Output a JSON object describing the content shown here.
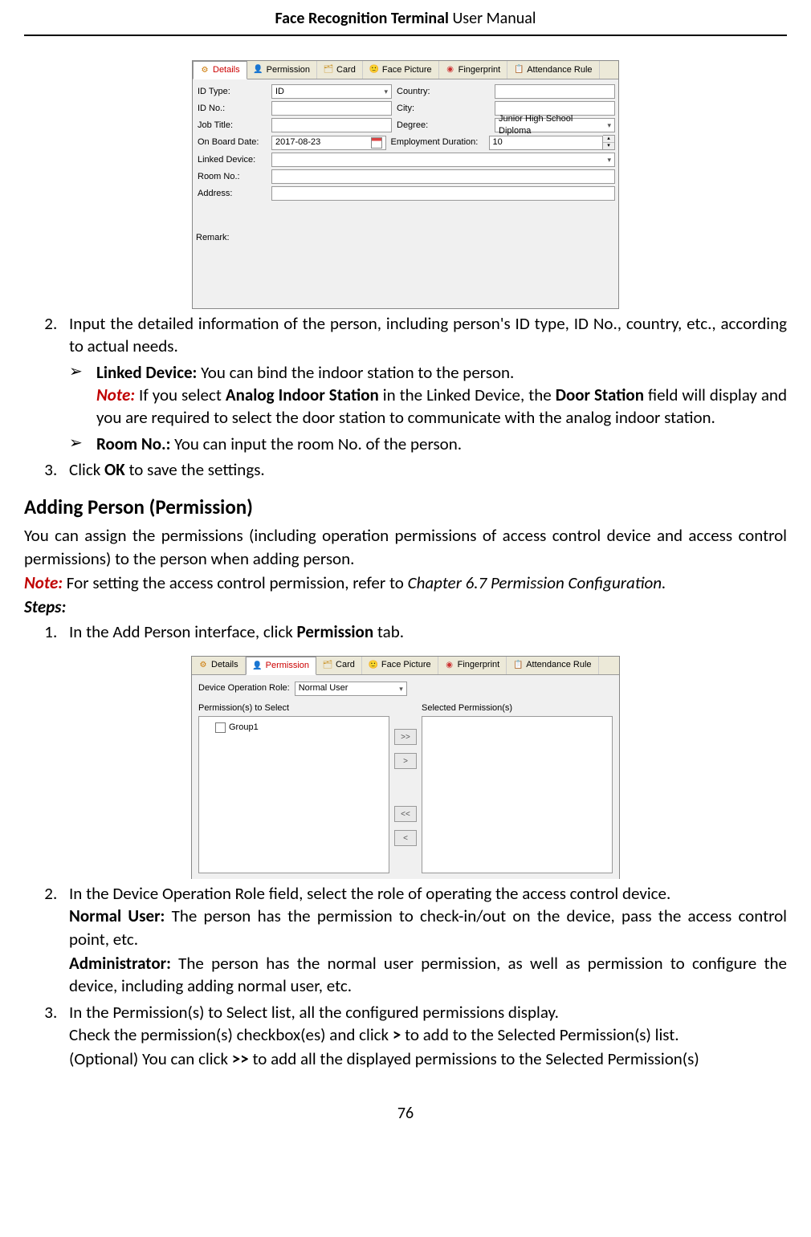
{
  "header": {
    "title_bold": "Face Recognition Terminal",
    "title_light": "  User Manual"
  },
  "page_number": "76",
  "screenshot1": {
    "tabs": [
      {
        "icon": "⚙",
        "label": "Details",
        "name": "tab-details",
        "active": true,
        "color": "#c00"
      },
      {
        "icon": "👤",
        "label": "Permission",
        "name": "tab-permission",
        "active": false
      },
      {
        "icon": "🗂",
        "label": "Card",
        "name": "tab-card",
        "active": false
      },
      {
        "icon": "🙂",
        "label": "Face Picture",
        "name": "tab-face-picture",
        "active": false
      },
      {
        "icon": "◉",
        "label": "Fingerprint",
        "name": "tab-fingerprint",
        "active": false
      },
      {
        "icon": "📋",
        "label": "Attendance Rule",
        "name": "tab-attendance-rule",
        "active": false
      }
    ],
    "rows": {
      "id_type_label": "ID Type:",
      "id_type_value": "ID",
      "country_label": "Country:",
      "id_no_label": "ID No.:",
      "city_label": "City:",
      "job_title_label": "Job Title:",
      "degree_label": "Degree:",
      "degree_value": "Junior High School Diploma",
      "onboard_label": "On Board Date:",
      "onboard_value": "2017-08-23",
      "duration_label": "Employment Duration:",
      "duration_value": "10",
      "linked_device_label": "Linked Device:",
      "room_no_label": "Room No.:",
      "address_label": "Address:",
      "remark_label": "Remark:"
    }
  },
  "screenshot2": {
    "tabs": [
      {
        "icon": "⚙",
        "label": "Details",
        "name": "tab-details",
        "active": false
      },
      {
        "icon": "👤",
        "label": "Permission",
        "name": "tab-permission",
        "active": true,
        "color": "#c00"
      },
      {
        "icon": "🗂",
        "label": "Card",
        "name": "tab-card",
        "active": false
      },
      {
        "icon": "🙂",
        "label": "Face Picture",
        "name": "tab-face-picture",
        "active": false
      },
      {
        "icon": "◉",
        "label": "Fingerprint",
        "name": "tab-fingerprint",
        "active": false
      },
      {
        "icon": "📋",
        "label": "Attendance Rule",
        "name": "tab-attendance-rule",
        "active": false
      }
    ],
    "role_label": "Device Operation Role:",
    "role_value": "Normal User",
    "left_title": "Permission(s) to Select",
    "right_title": "Selected Permission(s)",
    "left_item": "Group1",
    "btn_add_all": ">>",
    "btn_add": ">",
    "btn_remove_all": "<<",
    "btn_remove": "<"
  },
  "body": {
    "li2_a": "Input the detailed information of the person, including person's ID type, ID No., country, etc., according to actual needs.",
    "linked_device_bold": "Linked Device:",
    "linked_device_text": " You can bind the indoor station to the person.",
    "note_label": "Note:",
    "linked_device_note_1": " If you select ",
    "linked_device_note_bold1": "Analog Indoor Station",
    "linked_device_note_2": " in the Linked Device, the ",
    "linked_device_note_bold2": "Door Station",
    "linked_device_note_3": " field will display and you are required to select the door station to communicate with the analog indoor station.",
    "room_no_bold": "Room No.:",
    "room_no_text": " You can input the room No. of the person.",
    "li3_a": "Click ",
    "li3_bold": "OK",
    "li3_b": " to save the settings.",
    "h3": "Adding Person (Permission)",
    "p_intro": "You can assign the permissions (including operation permissions of access control device and access control permissions) to the person when adding person.",
    "p_note": " For setting the access control permission, refer to ",
    "p_note_italic": "Chapter 6.7 Permission Configuration.",
    "steps_label": "Steps:",
    "s1_a": "In the Add Person interface, click ",
    "s1_bold": "Permission",
    "s1_b": " tab.",
    "s2": "In the Device Operation Role field, select the role of operating the access control device.",
    "s2_nu_bold": "Normal User:",
    "s2_nu_text": " The person has the permission to check-in/out on the device, pass the access control point, etc.",
    "s2_ad_bold": "Administrator:",
    "s2_ad_text": " The person has the normal user permission, as well as permission to configure the device, including adding normal user, etc.",
    "s3": "In the Permission(s) to Select list, all the configured permissions display.",
    "s3_line2_a": "Check the permission(s) checkbox(es) and click ",
    "s3_line2_bold": ">",
    "s3_line2_b": " to add to the Selected Permission(s) list.",
    "s3_line3_a": "(Optional) You can click ",
    "s3_line3_bold": ">>",
    "s3_line3_b": " to add all the displayed permissions to the Selected Permission(s)"
  }
}
